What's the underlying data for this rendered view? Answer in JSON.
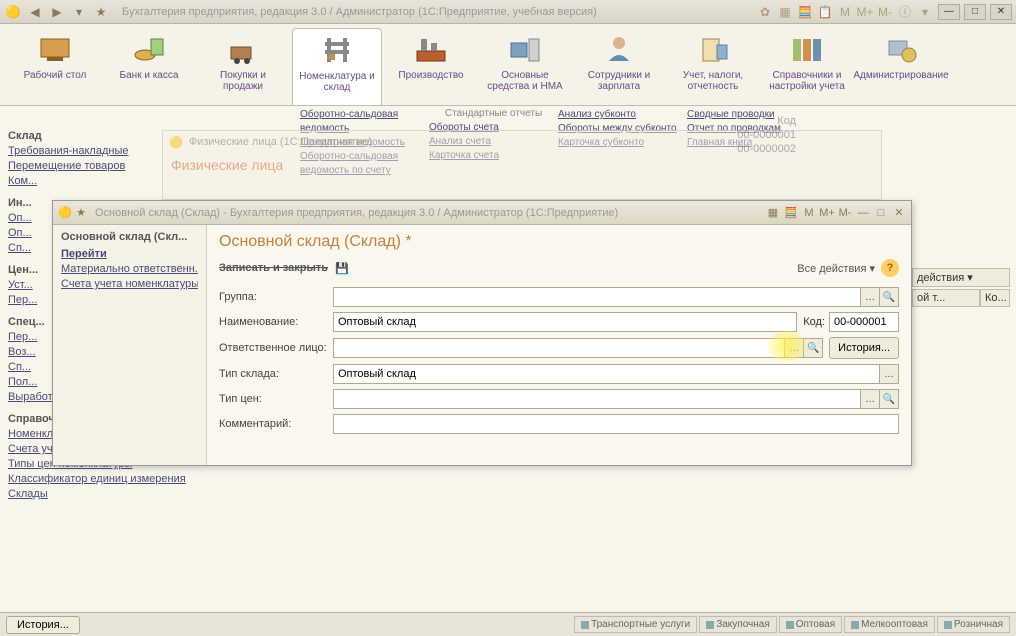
{
  "titlebar": {
    "title": "Бухгалтерия предприятия, редакция 3.0 / Администратор   (1С:Предприятие, учебная версия)",
    "mem": [
      "M",
      "M+",
      "M-"
    ]
  },
  "maintb": [
    {
      "label": "Рабочий стол"
    },
    {
      "label": "Банк и касса"
    },
    {
      "label": "Покупки и продажи"
    },
    {
      "label": "Номенклатура и склад"
    },
    {
      "label": "Производство"
    },
    {
      "label": "Основные средства и НМА"
    },
    {
      "label": "Сотрудники и зарплата"
    },
    {
      "label": "Учет, налоги, отчетность"
    },
    {
      "label": "Справочники и настройки учета"
    },
    {
      "label": "Администрирование"
    }
  ],
  "reports": {
    "heading": "Стандартные отчеты",
    "col1": [
      "Оборотно-сальдовая ведомость",
      "Шахматная ведомость",
      "Оборотно-сальдовая ведомость по счету"
    ],
    "col2": [
      "Обороты счета",
      "Анализ счета",
      "Карточка счета"
    ],
    "col3": [
      "Анализ субконто",
      "Обороты между субконто",
      "Карточка субконто"
    ],
    "col4": [
      "Сводные проводки",
      "Отчет по проводкам",
      "Главная книга"
    ]
  },
  "sidebar": {
    "g1": {
      "head": "Склад",
      "items": [
        "Требования-накладные",
        "Перемещение товаров",
        "Ком..."
      ]
    },
    "g2": {
      "head": "Ин...",
      "items": [
        "Оп...",
        "Оп...",
        "Сп..."
      ]
    },
    "g3": {
      "head": "Цен...",
      "items": [
        "Уст...",
        "Пер..."
      ]
    },
    "g4": {
      "head": "Спец...",
      "items": [
        "Пер...",
        "Воз...",
        "Сп...",
        "Пол...",
        "Выработка материалов"
      ]
    },
    "g5": {
      "head": "Справочники и настройки",
      "items": [
        "Номенклатура",
        "Счета учета номенклатуры",
        "Типы цен номенклатуры",
        "Классификатор единиц измерения",
        "Склады"
      ]
    }
  },
  "bgwin": {
    "titlebar": "Физические лица   (1С:Предприятие)",
    "heading": "Физические лица"
  },
  "bgcodes": {
    "label": "Код",
    "c1": "00-0000001",
    "c2": "00-0000002"
  },
  "rightcol": {
    "actions": "действия ▾",
    "cols": [
      "ой т...",
      "Ко..."
    ]
  },
  "modal": {
    "titlebar": "Основной склад (Склад) - Бухгалтерия предприятия, редакция 3.0 / Администратор   (1С:Предприятие)",
    "mem": [
      "M",
      "M+",
      "M-"
    ],
    "side": {
      "title": "Основной склад (Скл...",
      "links": [
        "Перейти",
        "Материально ответственн...",
        "Счета учета номенклатуры"
      ]
    },
    "main": {
      "title": "Основной склад (Склад) *",
      "save": "Записать и закрыть",
      "all_actions": "Все действия ▾",
      "fields": {
        "group": {
          "label": "Группа:",
          "value": ""
        },
        "name": {
          "label": "Наименование:",
          "value": "Оптовый склад"
        },
        "code": {
          "label": "Код:",
          "value": "00-000001"
        },
        "resp": {
          "label": "Ответственное лицо:",
          "value": ""
        },
        "history": "История...",
        "type": {
          "label": "Тип склада:",
          "value": "Оптовый склад"
        },
        "price_type": {
          "label": "Тип цен:",
          "value": ""
        },
        "comment": {
          "label": "Комментарий:",
          "value": ""
        }
      }
    }
  },
  "statusbar": {
    "history": "История...",
    "tabs": [
      "Транспортные услуги",
      "Закупочная",
      "Оптовая",
      "Мелкооптовая",
      "Розничная"
    ]
  }
}
